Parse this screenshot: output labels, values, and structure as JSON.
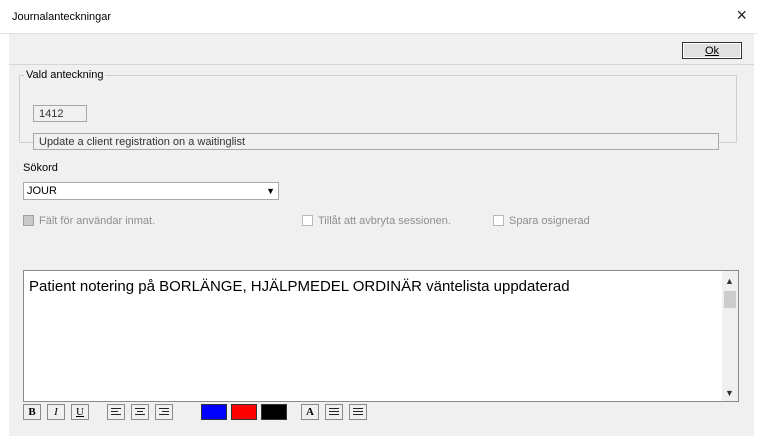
{
  "window": {
    "title": "Journalanteckningar",
    "close_glyph": "×"
  },
  "toolbar": {
    "ok_label": "Ok"
  },
  "note_group": {
    "legend": "Vald anteckning",
    "note_id": "1412",
    "note_description": "Update a client registration on a waitinglist"
  },
  "keyword": {
    "label": "Sökord",
    "selected": "JOUR"
  },
  "options": {
    "user_input_field": "Fält för användar inmat.",
    "allow_cancel_session": "Tillåt att avbryta sessionen.",
    "save_unsigned": "Spara osignerad"
  },
  "editor": {
    "text": "Patient notering på BORLÄNGE, HJÄLPMEDEL ORDINÄR väntelista uppdaterad"
  },
  "format_toolbar": {
    "bold": "B",
    "italic": "I",
    "underline": "U",
    "font_letter": "A",
    "colors": {
      "blue": "#0000ff",
      "red": "#ff0000",
      "black": "#000000"
    }
  }
}
